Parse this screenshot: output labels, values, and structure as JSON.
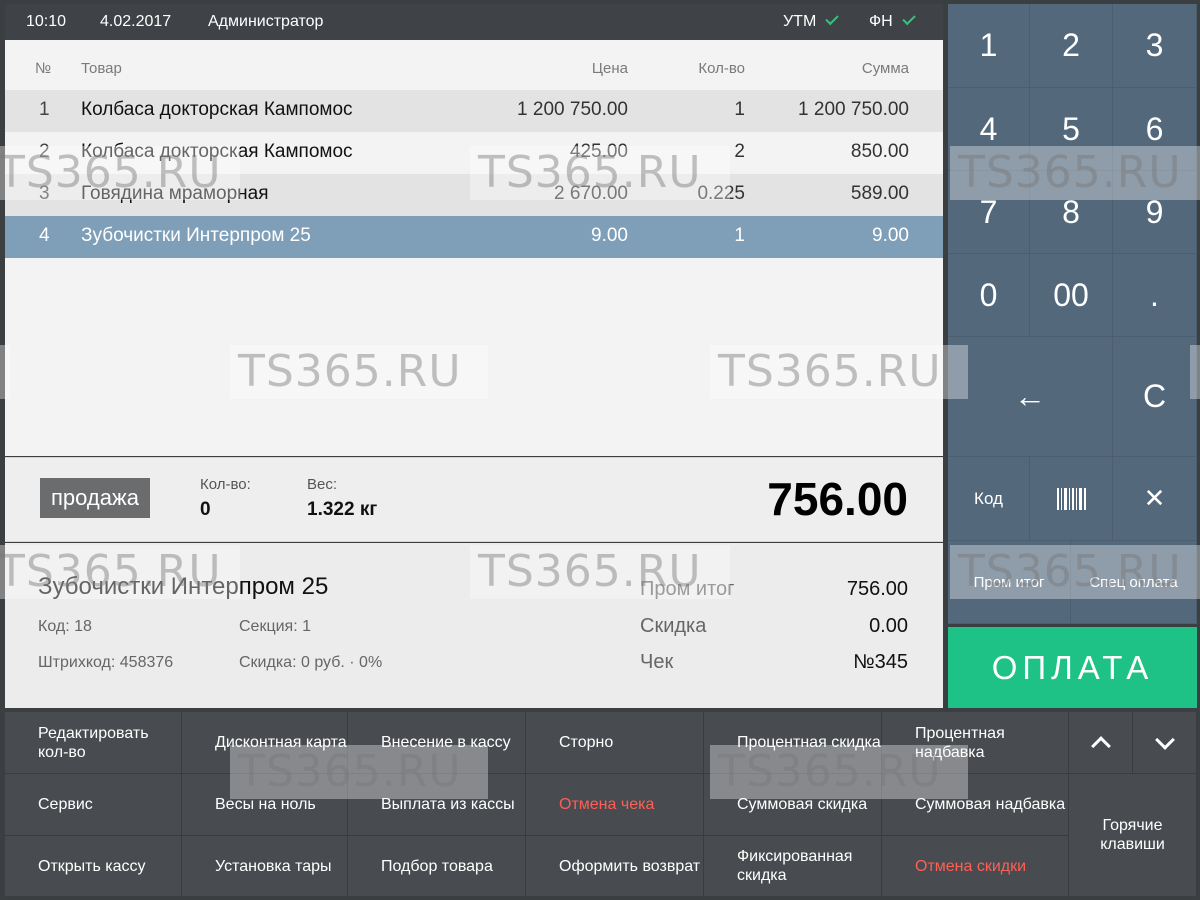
{
  "status_bar": {
    "time": "10:10",
    "date": "4.02.2017",
    "user": "Администратор",
    "utm_label": "УТМ",
    "fn_label": "ФН"
  },
  "table": {
    "headers": {
      "num": "№",
      "name": "Товар",
      "price": "Цена",
      "qty": "Кол-во",
      "sum": "Сумма"
    },
    "rows": [
      {
        "num": "1",
        "name": "Колбаса докторская Кампомос",
        "price": "1 200 750.00",
        "qty": "1",
        "sum": "1 200 750.00"
      },
      {
        "num": "2",
        "name": "Колбаса докторская Кампомос",
        "price": "425.00",
        "qty": "2",
        "sum": "850.00"
      },
      {
        "num": "3",
        "name": "Говядина мраморная",
        "price": "2 670.00",
        "qty": "0.225",
        "sum": "589.00"
      },
      {
        "num": "4",
        "name": "Зубочистки Интерпром 25",
        "price": "9.00",
        "qty": "1",
        "sum": "9.00"
      }
    ]
  },
  "totals": {
    "mode": "продажа",
    "qty_label": "Кол-во:",
    "qty_value": "0",
    "weight_label": "Вес:",
    "weight_value": "1.322 кг",
    "amount": "756.00"
  },
  "item_info": {
    "title": "Зубочистки Интерпром 25",
    "code": "Код: 18",
    "section": "Секция: 1",
    "barcode": "Штрихкод: 458376",
    "discount": "Скидка: 0 руб. · 0%",
    "subtotal_label": "Пром итог",
    "subtotal_value": "756.00",
    "discount_label": "Скидка",
    "discount_value": "0.00",
    "check_label": "Чек",
    "check_value": "№345"
  },
  "keypad": {
    "k1": "1",
    "k2": "2",
    "k3": "3",
    "k4": "4",
    "k5": "5",
    "k6": "6",
    "k7": "7",
    "k8": "8",
    "k9": "9",
    "k0": "0",
    "k00": "00",
    "kdot": ".",
    "back": "←",
    "clear": "C",
    "code": "Код",
    "close": "✕",
    "subtotal": "Пром итог",
    "special_pay": "Спец оплата",
    "pay": "ОПЛАТА"
  },
  "functions": {
    "edit_qty": "Редактировать кол-во",
    "discount_card": "Дисконтная карта",
    "cash_in": "Внесение в кассу",
    "storno": "Сторно",
    "percent_discount": "Процентная скидка",
    "percent_markup": "Процентная надбавка",
    "service": "Сервис",
    "zero_scale": "Весы на ноль",
    "cash_out": "Выплата из кассы",
    "cancel_check": "Отмена чека",
    "sum_discount": "Суммовая скидка",
    "sum_markup": "Суммовая надбавка",
    "open_register": "Открыть кассу",
    "tare": "Установка тары",
    "product_search": "Подбор товара",
    "refund": "Оформить возврат",
    "fixed_discount": "Фиксированная скидка",
    "cancel_discount": "Отмена скидки",
    "hotkeys": "Горячие клавиши"
  },
  "watermark": "TS365.RU",
  "colors": {
    "selected_row": "#7f9fb9",
    "pay_button": "#1ec287",
    "keypad": "#54687b",
    "alert_text": "#ff5f55",
    "status_ok": "#35c47a"
  }
}
